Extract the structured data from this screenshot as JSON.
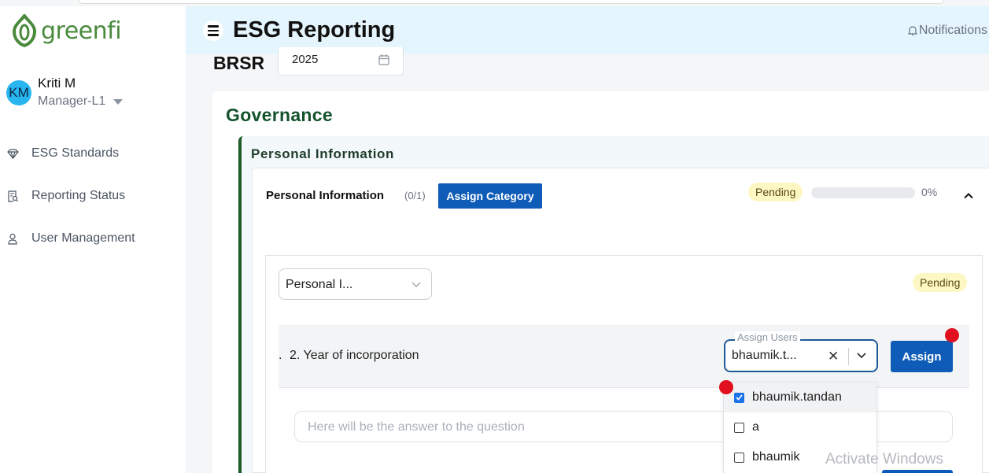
{
  "app": {
    "logo_text": "greenfi",
    "brand_color": "#4a8a3c",
    "accent_color": "#0e5bb8"
  },
  "user": {
    "initials": "KM",
    "name": "Kriti M",
    "role": "Manager-L1"
  },
  "sidebar": {
    "items": [
      {
        "label": "ESG Standards",
        "icon": "diamond-icon"
      },
      {
        "label": "Reporting Status",
        "icon": "report-search-icon"
      },
      {
        "label": "User Management",
        "icon": "user-icon"
      }
    ]
  },
  "header": {
    "title": "ESG Reporting",
    "notifications_label": "Notifications"
  },
  "report": {
    "framework": "BRSR",
    "year": "2025"
  },
  "section": {
    "title": "Governance",
    "subsection_title": "Personal Information"
  },
  "category": {
    "title": "Personal Information",
    "count": "(0/1)",
    "assign_label": "Assign Category",
    "status": "Pending",
    "progress_percent": 0,
    "progress_label": "0%"
  },
  "subcategory": {
    "selected": "Personal I...",
    "status": "Pending"
  },
  "question": {
    "prefix": ".",
    "text": "2. Year of incorporation",
    "assign_users_label": "Assign Users",
    "assign_users_value": "bhaumik.t...",
    "assign_button": "Assign",
    "answer_placeholder": "Here will be the answer to the question"
  },
  "user_dropdown": {
    "options": [
      {
        "label": "bhaumik.tandan",
        "checked": true
      },
      {
        "label": "a",
        "checked": false
      },
      {
        "label": "bhaumik",
        "checked": false
      }
    ]
  },
  "os": {
    "watermark": "Activate Windows"
  }
}
